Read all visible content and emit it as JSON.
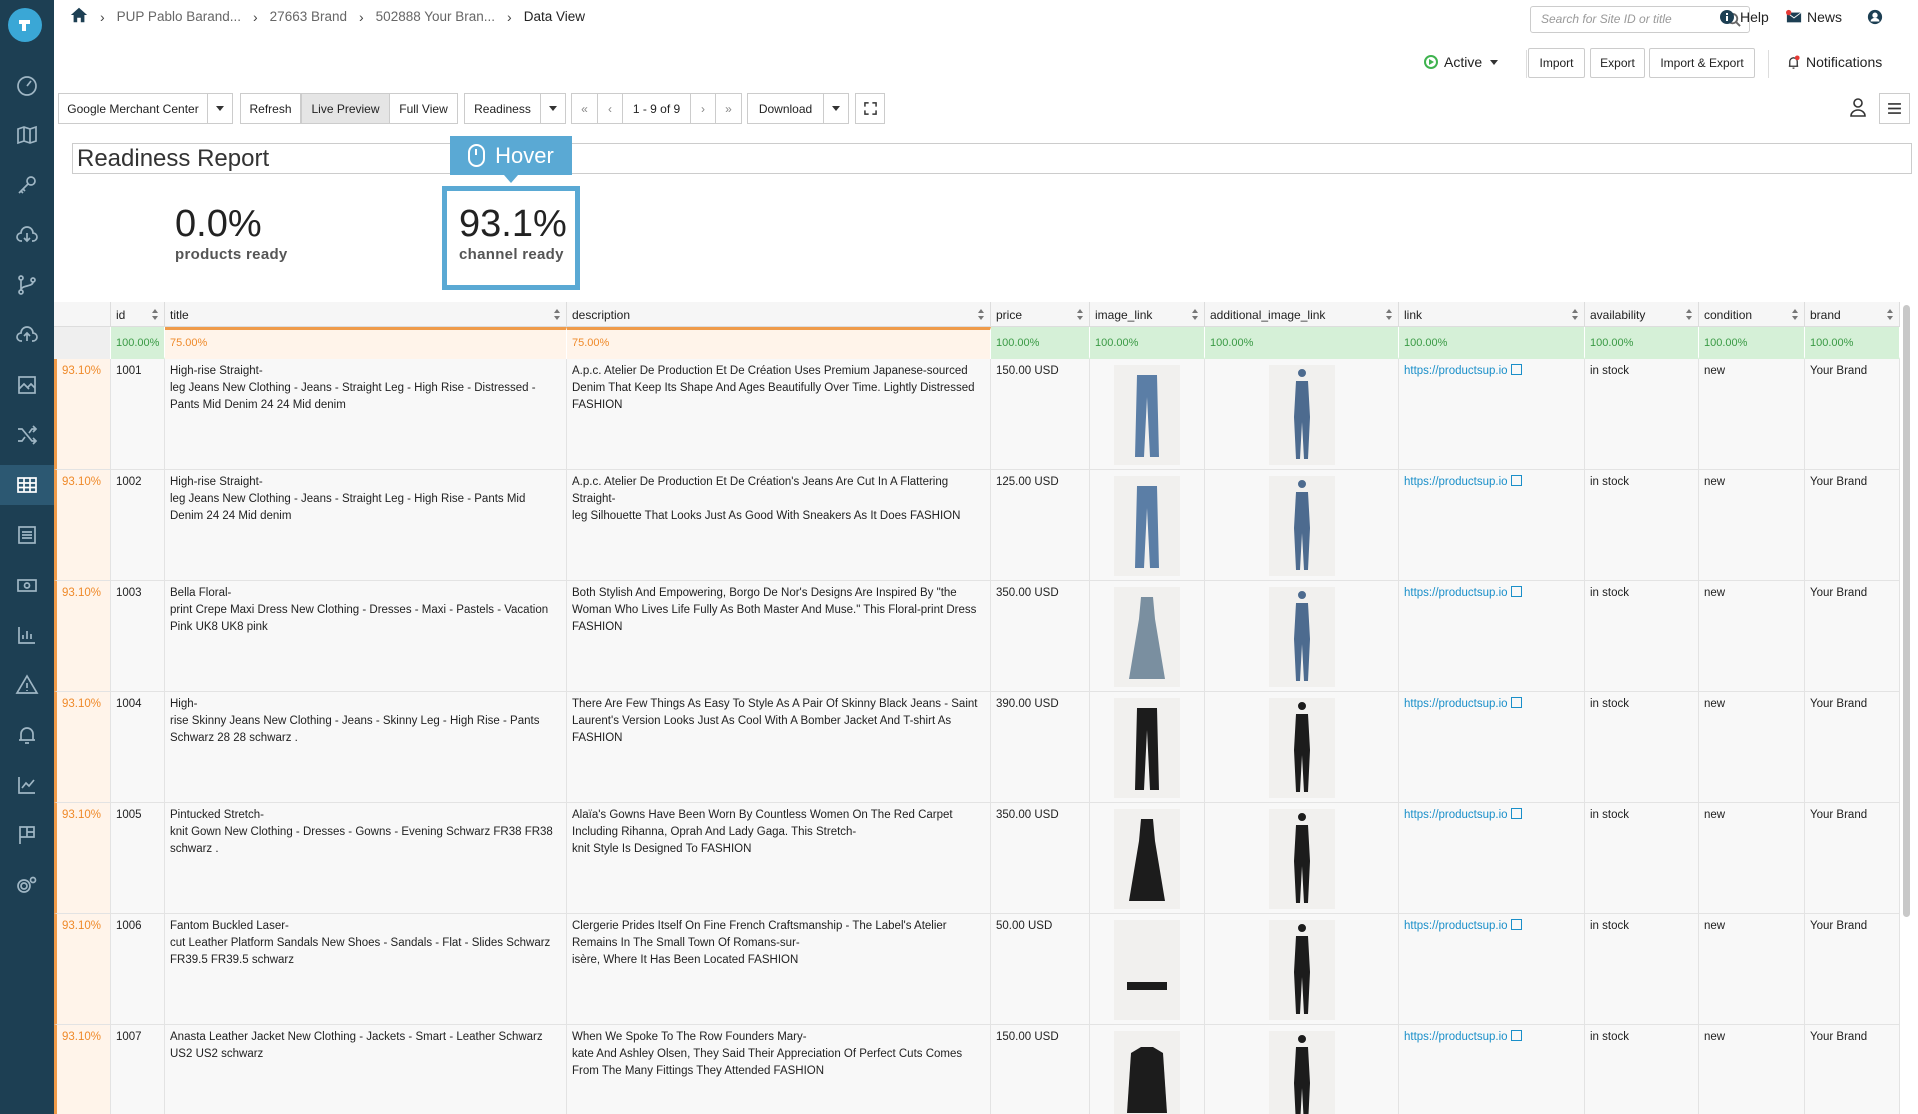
{
  "breadcrumbs": [
    "PUP Pablo Barand...",
    "27663 Brand",
    "502888 Your Bran...",
    "Data View"
  ],
  "search": {
    "placeholder": "Search for Site ID or title"
  },
  "top_links": {
    "help": "Help",
    "news": "News"
  },
  "status": {
    "label": "Active"
  },
  "actions": {
    "import": "Import",
    "export": "Export",
    "import_export": "Import & Export",
    "notifications": "Notifications"
  },
  "toolbar": {
    "channel": "Google Merchant Center",
    "refresh": "Refresh",
    "live_preview": "Live Preview",
    "full_view": "Full View",
    "readiness": "Readiness",
    "first": "«",
    "prev": "‹",
    "page": "1 - 9 of 9",
    "next": "›",
    "last": "»",
    "download": "Download"
  },
  "report": {
    "title": "Readiness Report",
    "products_value": "0.0%",
    "products_label": "products ready",
    "channel_value": "93.1%",
    "channel_label": "channel ready",
    "hover_label": "Hover"
  },
  "columns": [
    "id",
    "title",
    "description",
    "price",
    "image_link",
    "additional_image_link",
    "link",
    "availability",
    "condition",
    "brand"
  ],
  "column_readiness": [
    "100.00%",
    "75.00%",
    "75.00%",
    "100.00%",
    "100.00%",
    "100.00%",
    "100.00%",
    "100.00%",
    "100.00%",
    "100.00%"
  ],
  "rows": [
    {
      "pct": "93.10%",
      "id": "1001",
      "title": "  High-rise Straight-\nleg Jeans New Clothing - Jeans - Straight Leg - High Rise - Distressed - Pants Mid Denim 24 24 Mid denim",
      "description": "A.p.c. Atelier De Production Et De Création Uses Premium Japanese-sourced Denim That Keep Its Shape And Ages Beautifully Over Time. Lightly Distressed FASHION",
      "price": "150.00 USD",
      "link": "https://productsup.io",
      "availability": "in stock",
      "condition": "new",
      "brand": "Your Brand",
      "image": "jeans-image",
      "extra_image": "model-jeans-image"
    },
    {
      "pct": "93.10%",
      "id": "1002",
      "title": "  High-rise Straight-\nleg Jeans New Clothing - Jeans - Straight Leg - High Rise - Pants Mid Denim 24 24 Mid denim",
      "description": "A.p.c. Atelier De Production Et De Création's Jeans Are Cut In A Flattering Straight-\nleg Silhouette That Looks Just As Good With Sneakers As It Does  FASHION",
      "price": "125.00 USD",
      "link": "https://productsup.io",
      "availability": "in stock",
      "condition": "new",
      "brand": "Your Brand",
      "image": "jeans-image",
      "extra_image": "model-jeans-image"
    },
    {
      "pct": "93.10%",
      "id": "1003",
      "title": "  Bella Floral-\nprint Crepe Maxi Dress New Clothing - Dresses - Maxi - Pastels - Vacation Pink UK8 UK8 pink",
      "description": "Both Stylish And Empowering, Borgo De Nor's Designs Are Inspired By \"the Woman Who Lives Life Fully As Both Master And Muse.\" This Floral-print Dress  FASHION",
      "price": "350.00 USD",
      "link": "https://productsup.io",
      "availability": "in stock",
      "condition": "new",
      "brand": "Your Brand",
      "image": "dress-image",
      "extra_image": "model-dress-image"
    },
    {
      "pct": "93.10%",
      "id": "1004",
      "title": "  High-\nrise Skinny Jeans New Clothing - Jeans - Skinny Leg - High Rise - Pants Schwarz 28 28 schwarz .",
      "description": "There Are Few Things As Easy To Style As A Pair Of Skinny Black Jeans - Saint Laurent's Version Looks Just As Cool With A Bomber Jacket And T-shirt As FASHION",
      "price": "390.00 USD",
      "link": "https://productsup.io",
      "availability": "in stock",
      "condition": "new",
      "brand": "Your Brand",
      "image": "black-jeans-image",
      "extra_image": "model-black-jeans-image"
    },
    {
      "pct": "93.10%",
      "id": "1005",
      "title": "  Pintucked Stretch-\nknit Gown New Clothing - Dresses - Gowns - Evening Schwarz FR38 FR38 schwarz .",
      "description": "Alaïa's Gowns Have Been Worn By Countless Women On The Red Carpet Including Rihanna, Oprah And Lady Gaga. This Stretch-\nknit Style Is Designed To FASHION",
      "price": "350.00 USD",
      "link": "https://productsup.io",
      "availability": "in stock",
      "condition": "new",
      "brand": "Your Brand",
      "image": "gown-image",
      "extra_image": "model-gown-image"
    },
    {
      "pct": "93.10%",
      "id": "1006",
      "title": "Fantom Buckled Laser-\ncut Leather Platform Sandals New Shoes - Sandals - Flat - Slides Schwarz  FR39.5 FR39.5 schwarz",
      "description": "Clergerie Prides Itself On Fine French Craftsmanship - The Label's Atelier Remains In The Small Town Of Romans-sur-\nisère, Where It Has Been Located  FASHION",
      "price": "50.00 USD",
      "link": "https://productsup.io",
      "availability": "in stock",
      "condition": "new",
      "brand": "Your Brand",
      "image": "sandal-image",
      "extra_image": "model-sandal-image"
    },
    {
      "pct": "93.10%",
      "id": "1007",
      "title": "  Anasta Leather Jacket New Clothing - Jackets - Smart - Leather Schwarz US2 US2 schwarz",
      "description": "When We Spoke To The Row Founders Mary-\nkate And Ashley Olsen, They Said Their Appreciation Of Perfect Cuts Comes From The Many Fittings They Attended  FASHION",
      "price": "150.00 USD",
      "link": "https://productsup.io",
      "availability": "in stock",
      "condition": "new",
      "brand": "Your Brand",
      "image": "jacket-image",
      "extra_image": "model-jacket-image"
    }
  ],
  "colors": {
    "sidebar": "#1d3f53",
    "accent": "#5aa9d4",
    "orange": "#ef8a2a",
    "green": "#3a9a45",
    "link": "#1a8fc9"
  }
}
